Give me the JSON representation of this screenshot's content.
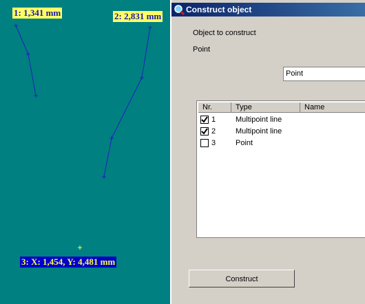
{
  "canvas": {
    "labels": {
      "line1": "1: 1,341 mm",
      "line2": "2: 2,831 mm",
      "point3": "3: X: 1,454, Y: 4,481 mm"
    }
  },
  "dialog": {
    "title": "Construct object",
    "object_caption": "Object to construct",
    "object_value": "Point",
    "combo_value": "Point",
    "list": {
      "columns": [
        "Nr.",
        "Type",
        "Name"
      ],
      "rows": [
        {
          "nr": "1",
          "type": "Multipoint line",
          "name": "",
          "checked": true
        },
        {
          "nr": "2",
          "type": "Multipoint line",
          "name": "",
          "checked": true
        },
        {
          "nr": "3",
          "type": "Point",
          "name": "",
          "checked": false
        }
      ]
    },
    "construct_label": "Construct"
  },
  "colors": {
    "canvas_bg": "#008080",
    "line": "#2020c0",
    "label_yellow": "#ffff66",
    "label_blue": "#0000cc",
    "title_bar": "#0a246a"
  },
  "icons": {
    "title": "magnifier-icon",
    "checkbox": "checkmark-icon"
  }
}
